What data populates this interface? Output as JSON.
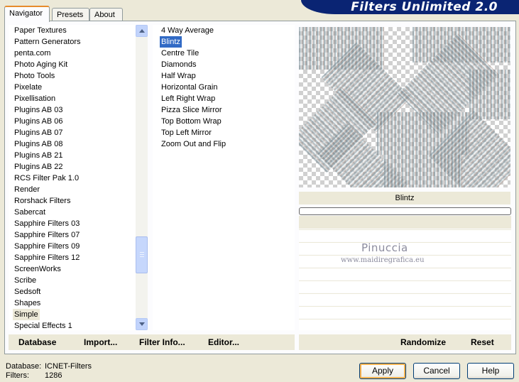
{
  "tabs": [
    {
      "label": "Navigator",
      "active": true
    },
    {
      "label": "Presets",
      "active": false
    },
    {
      "label": "About",
      "active": false
    }
  ],
  "banner": {
    "title": "Filters Unlimited 2.0",
    "color": "#0a2473"
  },
  "categories": {
    "items": [
      "Paper Textures",
      "Pattern Generators",
      "penta.com",
      "Photo Aging Kit",
      "Photo Tools",
      "Pixelate",
      "Pixellisation",
      "Plugins AB 03",
      "Plugins AB 06",
      "Plugins AB 07",
      "Plugins AB 08",
      "Plugins AB 21",
      "Plugins AB 22",
      "RCS Filter Pak 1.0",
      "Render",
      "Rorshack Filters",
      "Sabercat",
      "Sapphire Filters 03",
      "Sapphire Filters 07",
      "Sapphire Filters 09",
      "Sapphire Filters 12",
      "ScreenWorks",
      "Scribe",
      "Sedsoft",
      "Shapes",
      "Simple",
      "Special Effects 1"
    ],
    "selected": "Simple"
  },
  "filters": {
    "items": [
      "4 Way Average",
      "Blintz",
      "Centre Tile",
      "Diamonds",
      "Half Wrap",
      "Horizontal Grain",
      "Left Right Wrap",
      "Pizza Slice Mirror",
      "Top Bottom Wrap",
      "Top Left Mirror",
      "Zoom Out and Flip"
    ],
    "selected": "Blintz"
  },
  "preview": {
    "filter_name": "Blintz"
  },
  "watermark": {
    "name": "Pinuccia",
    "url": "www.maidiregrafica.eu"
  },
  "link_buttons": {
    "database": "Database",
    "import": "Import...",
    "filter_info": "Filter Info...",
    "editor": "Editor...",
    "randomize": "Randomize",
    "reset": "Reset"
  },
  "info": {
    "database_label": "Database:",
    "database_value": "ICNET-Filters",
    "filters_label": "Filters:",
    "filters_value": "1286"
  },
  "buttons": {
    "apply": "Apply",
    "cancel": "Cancel",
    "help": "Help"
  },
  "colors": {
    "selection": "#316ac5",
    "accent": "#f8b351"
  }
}
